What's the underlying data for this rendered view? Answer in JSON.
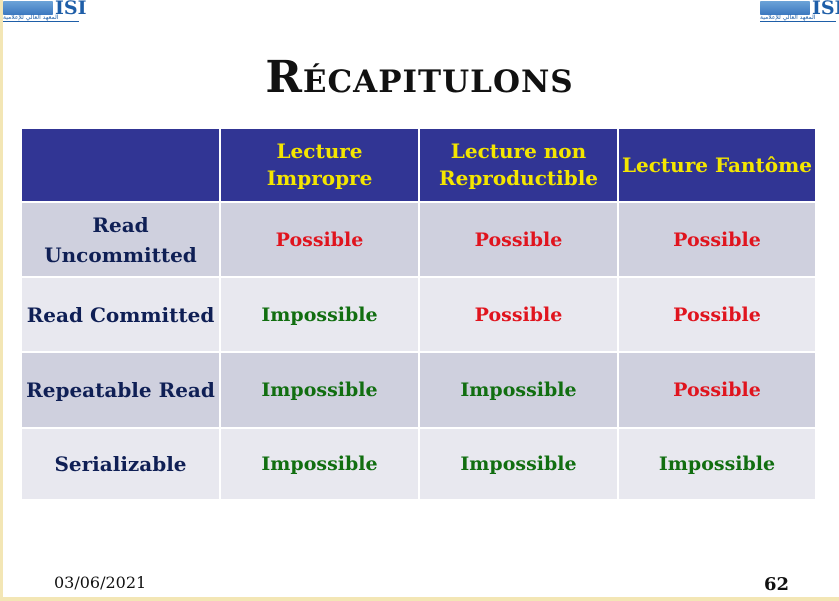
{
  "logo": {
    "letters": "ISI",
    "arabic": "المعهد العالي للإعلامية"
  },
  "title": "Récapitulons",
  "table": {
    "corner": "",
    "columns": [
      "Lecture Impropre",
      "Lecture non Reproductible",
      "Lecture Fantôme"
    ],
    "rows": [
      {
        "label": "Read Uncommitted",
        "values": [
          "Possible",
          "Possible",
          "Possible"
        ]
      },
      {
        "label": "Read Committed",
        "values": [
          "Impossible",
          "Possible",
          "Possible"
        ]
      },
      {
        "label": "Repeatable Read",
        "values": [
          "Impossible",
          "Impossible",
          "Possible"
        ]
      },
      {
        "label": "Serializable",
        "values": [
          "Impossible",
          "Impossible",
          "Impossible"
        ]
      }
    ]
  },
  "colors": {
    "header_bg": "#313594",
    "header_text": "#f4e600",
    "possible": "#e0141e",
    "impossible": "#116e10",
    "row_label": "#0f1f55"
  },
  "footer": {
    "date": "03/06/2021",
    "page": "62"
  }
}
